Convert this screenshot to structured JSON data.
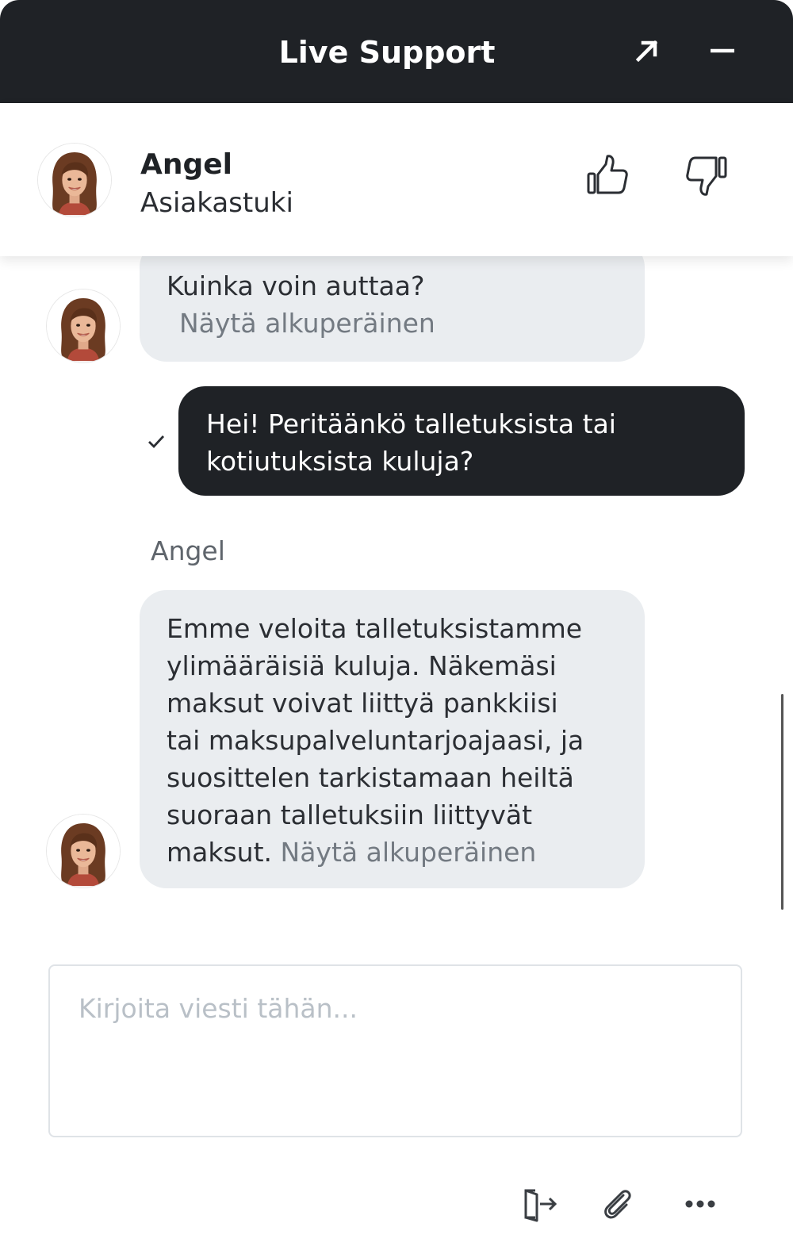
{
  "header": {
    "title": "Live Support",
    "popout_icon": "arrow-up-right-icon",
    "minimize_icon": "minimize-icon"
  },
  "agent": {
    "name": "Angel",
    "role": "Asiakastuki",
    "avatar_icon": "agent-avatar",
    "thumbs_up_icon": "thumbs-up-icon",
    "thumbs_down_icon": "thumbs-down-icon"
  },
  "messages": [
    {
      "from": "agent",
      "text": "Kuinka voin auttaa?",
      "show_original": "Näytä alkuperäinen"
    },
    {
      "from": "user",
      "text_lines": [
        "Hei! Peritäänkö talletuksista tai",
        "kotiutuksista kuluja?"
      ],
      "status_icon": "checkmark-icon"
    },
    {
      "from": "agent",
      "sender": "Angel",
      "text_lines": [
        "Emme veloita talletuksistamme",
        "ylimääräisiä kuluja. Näkemäsi",
        "maksut voivat liittyä pankkiisi",
        "tai maksupalveluntarjoajaasi, ja",
        "suosittelen tarkistamaan heiltä",
        "suoraan talletuksiin liittyvät",
        "maksut."
      ],
      "show_original": "Näytä alkuperäinen"
    }
  ],
  "composer": {
    "placeholder": "Kirjoita viesti tähän...",
    "value": ""
  },
  "toolbar": {
    "end_chat_icon": "exit-door-icon",
    "attach_icon": "paperclip-icon",
    "more_icon": "more-dots-icon"
  },
  "colors": {
    "header_bg": "#1f2226",
    "user_bubble": "#1f2226",
    "agent_bubble": "#eaedf0",
    "muted_link": "#737a82"
  }
}
